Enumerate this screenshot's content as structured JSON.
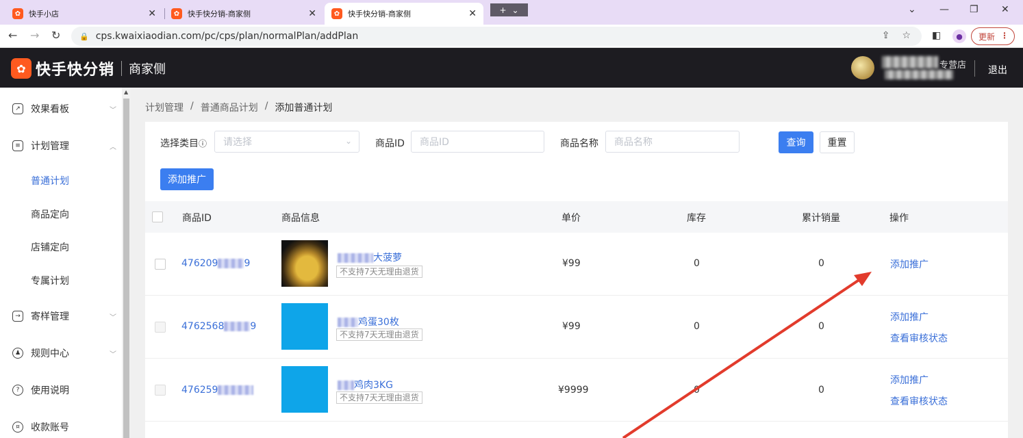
{
  "browser": {
    "tabs": [
      {
        "icon": "kuaishou-icon",
        "title": "快手小店"
      },
      {
        "icon": "kuaishou-icon",
        "title": "快手快分销-商家侧"
      },
      {
        "icon": "kuaishou-icon",
        "title": "快手快分销-商家侧"
      }
    ],
    "url": "cps.kwaixiaodian.com/pc/cps/plan/normalPlan/addPlan",
    "update_label": "更新"
  },
  "header": {
    "logo_text": "快手快分销",
    "logo_side": "商家侧",
    "shop_suffix": "专营店",
    "logout": "退出"
  },
  "sidebar": {
    "items": [
      {
        "label": "效果看板",
        "icon": "chart-icon"
      },
      {
        "label": "计划管理",
        "icon": "list-icon"
      },
      {
        "label": "寄样管理",
        "icon": "send-icon"
      },
      {
        "label": "规则中心",
        "icon": "rules-icon"
      },
      {
        "label": "使用说明",
        "icon": "help-icon"
      },
      {
        "label": "收款账号",
        "icon": "wallet-icon"
      }
    ],
    "subitems": [
      "普通计划",
      "商品定向",
      "店铺定向",
      "专属计划"
    ]
  },
  "breadcrumb": {
    "items": [
      "计划管理",
      "普通商品计划",
      "添加普通计划"
    ],
    "separator": "/"
  },
  "filters": {
    "category_label": "选择类目",
    "category_placeholder": "请选择",
    "id_label": "商品ID",
    "id_placeholder": "商品ID",
    "name_label": "商品名称",
    "name_placeholder": "商品名称",
    "query": "查询",
    "reset": "重置",
    "add": "添加推广"
  },
  "table": {
    "headers": [
      "商品ID",
      "商品信息",
      "单价",
      "库存",
      "累计销量",
      "操作"
    ],
    "rows": [
      {
        "id_prefix": "476209",
        "id_suffix": "9",
        "name": "大菠萝",
        "tag": "不支持7天无理由退货",
        "price": "¥99",
        "stock": "0",
        "sales": "0",
        "actions": [
          "添加推广"
        ]
      },
      {
        "id_prefix": "4762568",
        "id_suffix": "9",
        "name": "鸡蛋30枚",
        "tag": "不支持7天无理由退货",
        "price": "¥99",
        "stock": "0",
        "sales": "0",
        "actions": [
          "添加推广",
          "查看审核状态"
        ]
      },
      {
        "id_prefix": "476259",
        "id_suffix": "",
        "name": "鸡肉3KG",
        "tag": "不支持7天无理由退货",
        "price": "¥9999",
        "stock": "0",
        "sales": "0",
        "actions": [
          "添加推广",
          "查看审核状态"
        ]
      }
    ]
  },
  "colors": {
    "brand": "#ff5a1f",
    "link": "#3a6fd8",
    "primary": "#3b7ef0",
    "annotation_arrow": "#e23b2c"
  }
}
